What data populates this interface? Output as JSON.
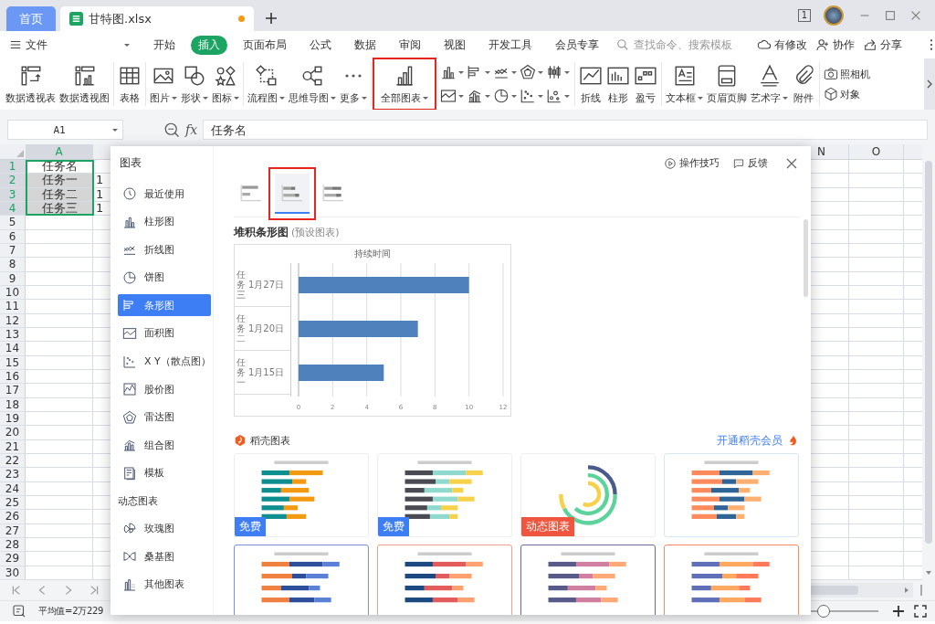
{
  "tabs": [
    {
      "label": "首页",
      "kind": "home",
      "selected": false
    },
    {
      "label": "甘特图.xlsx",
      "kind": "file",
      "selected": true,
      "unsaved": true
    }
  ],
  "window_count": "1",
  "menu": {
    "file": "文件",
    "tabs": [
      {
        "label": "开始",
        "selected": false
      },
      {
        "label": "插入",
        "selected": true
      },
      {
        "label": "页面布局",
        "selected": false
      },
      {
        "label": "公式",
        "selected": false
      },
      {
        "label": "数据",
        "selected": false
      },
      {
        "label": "审阅",
        "selected": false
      },
      {
        "label": "视图",
        "selected": false
      },
      {
        "label": "开发工具",
        "selected": false
      },
      {
        "label": "会员专享",
        "selected": false
      }
    ],
    "search": {
      "placeholder": "查找命令、搜索模板"
    },
    "actions": [
      {
        "label": "有修改"
      },
      {
        "label": "协作"
      },
      {
        "label": "分享"
      }
    ]
  },
  "ribbon": {
    "groups": [
      [
        {
          "label": "数据透视表",
          "dropdown": false,
          "highlighted": false
        },
        {
          "label": "数据透视图",
          "dropdown": false,
          "highlighted": false
        }
      ],
      [
        {
          "label": "表格",
          "dropdown": false,
          "highlighted": false
        }
      ],
      [
        {
          "label": "图片",
          "dropdown": true,
          "highlighted": false
        },
        {
          "label": "形状",
          "dropdown": true,
          "highlighted": false
        },
        {
          "label": "图标",
          "dropdown": true,
          "highlighted": false
        }
      ],
      [
        {
          "label": "流程图",
          "dropdown": true,
          "highlighted": false
        },
        {
          "label": "思维导图",
          "dropdown": true,
          "highlighted": false
        },
        {
          "label": "更多",
          "dropdown": true,
          "highlighted": false
        }
      ],
      [
        {
          "label": "全部图表",
          "dropdown": true,
          "highlighted": true
        }
      ],
      [
        {
          "label": "折线",
          "dropdown": false,
          "highlighted": false
        },
        {
          "label": "柱形",
          "dropdown": false,
          "highlighted": false
        },
        {
          "label": "盈亏",
          "dropdown": false,
          "highlighted": false
        }
      ],
      [
        {
          "label": "文本框",
          "dropdown": true,
          "highlighted": false
        },
        {
          "label": "页眉页脚",
          "dropdown": false,
          "highlighted": false
        },
        {
          "label": "艺术字",
          "dropdown": true,
          "highlighted": false
        },
        {
          "label": "附件",
          "dropdown": false,
          "highlighted": false
        }
      ]
    ],
    "chart_shortcuts": [
      {
        "dropdown": true
      },
      {
        "dropdown": true
      },
      {
        "dropdown": true
      },
      {
        "dropdown": true
      },
      {
        "dropdown": true
      },
      {
        "dropdown": true
      },
      {
        "dropdown": true
      },
      {
        "dropdown": true
      },
      {
        "dropdown": true
      },
      {
        "dropdown": true
      }
    ],
    "small_items": [
      {
        "label": "照相机"
      },
      {
        "label": "对象"
      }
    ]
  },
  "formula_bar": {
    "cell_ref": "A1",
    "fx_label": "fx",
    "value": "任务名"
  },
  "sheet": {
    "columns": [
      {
        "label": "A",
        "selected": true
      },
      {
        "label": "N",
        "selected": false
      },
      {
        "label": "O",
        "selected": false
      }
    ],
    "rows": [
      {
        "label": "1",
        "selected": true,
        "cells": [
          {
            "text": "任务名",
            "active": true
          }
        ]
      },
      {
        "label": "2",
        "selected": true,
        "cells": [
          {
            "text": "任务一",
            "active": false
          },
          {
            "text": "1",
            "active": false
          }
        ]
      },
      {
        "label": "3",
        "selected": true,
        "cells": [
          {
            "text": "任务二",
            "active": false
          },
          {
            "text": "1",
            "active": false
          }
        ]
      },
      {
        "label": "4",
        "selected": true,
        "cells": [
          {
            "text": "任务三",
            "active": false
          },
          {
            "text": "1",
            "active": false
          }
        ]
      },
      {
        "label": "5",
        "selected": false
      },
      {
        "label": "6",
        "selected": false
      },
      {
        "label": "7",
        "selected": false
      },
      {
        "label": "8",
        "selected": false
      },
      {
        "label": "9",
        "selected": false
      },
      {
        "label": "10",
        "selected": false
      },
      {
        "label": "11",
        "selected": false
      },
      {
        "label": "12",
        "selected": false
      },
      {
        "label": "13",
        "selected": false
      },
      {
        "label": "14",
        "selected": false
      },
      {
        "label": "15",
        "selected": false
      },
      {
        "label": "16",
        "selected": false
      },
      {
        "label": "17",
        "selected": false
      },
      {
        "label": "18",
        "selected": false
      },
      {
        "label": "19",
        "selected": false
      },
      {
        "label": "20",
        "selected": false
      },
      {
        "label": "21",
        "selected": false
      },
      {
        "label": "22",
        "selected": false
      },
      {
        "label": "23",
        "selected": false
      },
      {
        "label": "24",
        "selected": false
      },
      {
        "label": "25",
        "selected": false
      },
      {
        "label": "26",
        "selected": false
      },
      {
        "label": "27",
        "selected": false
      },
      {
        "label": "28",
        "selected": false
      },
      {
        "label": "29",
        "selected": false
      },
      {
        "label": "30",
        "selected": false
      }
    ]
  },
  "status_bar": {
    "summary": "平均值=2万229",
    "zoom_slider": {
      "level": 0.6
    }
  },
  "dialog": {
    "title": "图表",
    "links": [
      {
        "label": "操作技巧",
        "kind": "tips"
      },
      {
        "label": "反馈",
        "kind": "feedback"
      }
    ],
    "categories": [
      {
        "label": "最近使用",
        "selected": false
      },
      {
        "label": "柱形图",
        "selected": false
      },
      {
        "label": "折线图",
        "selected": false
      },
      {
        "label": "饼图",
        "selected": false
      },
      {
        "label": "条形图",
        "selected": true
      },
      {
        "label": "面积图",
        "selected": false
      },
      {
        "label": "X Y（散点图）",
        "selected": false
      },
      {
        "label": "股价图",
        "selected": false
      },
      {
        "label": "雷达图",
        "selected": false
      },
      {
        "label": "组合图",
        "selected": false
      },
      {
        "label": "模板",
        "selected": false
      }
    ],
    "dynamic_section": "动态图表",
    "dynamic_categories": [
      {
        "label": "玫瑰图",
        "selected": false
      },
      {
        "label": "桑基图",
        "selected": false
      },
      {
        "label": "其他图表",
        "selected": false
      }
    ],
    "subtypes": [
      {
        "selected": false,
        "highlighted": false
      },
      {
        "selected": true,
        "highlighted": true
      },
      {
        "selected": false,
        "highlighted": false
      }
    ],
    "preview": {
      "title": "堆积条形图",
      "note": "(预设图表)",
      "category_groups": [
        "任务三",
        "任务二",
        "任务一"
      ],
      "chart_data": {
        "type": "bar",
        "orientation": "horizontal",
        "grid": true,
        "title": "持续时间",
        "categories": [
          "1月27日",
          "1月20日",
          "1月15日"
        ],
        "series": [
          {
            "color": "#4f81bd",
            "values": [
              10,
              7,
              5
            ]
          }
        ],
        "xlim": [
          0,
          12
        ],
        "xticks": [
          0,
          2,
          4,
          6,
          8,
          10,
          12
        ]
      }
    },
    "templates": {
      "title": "稻壳图表",
      "link": "开通稻壳会员",
      "items": [
        {
          "kind": "bars",
          "badge": "免费",
          "color": "#3d7ef5"
        },
        {
          "kind": "bars",
          "badge": "免费",
          "color": "#3d7ef5"
        },
        {
          "kind": "rings",
          "badge": "动态图表",
          "color": "#f0553d"
        },
        {
          "kind": "bars"
        },
        {
          "kind": "bars"
        },
        {
          "kind": "bars"
        },
        {
          "kind": "bars"
        },
        {
          "kind": "bars"
        }
      ]
    }
  }
}
